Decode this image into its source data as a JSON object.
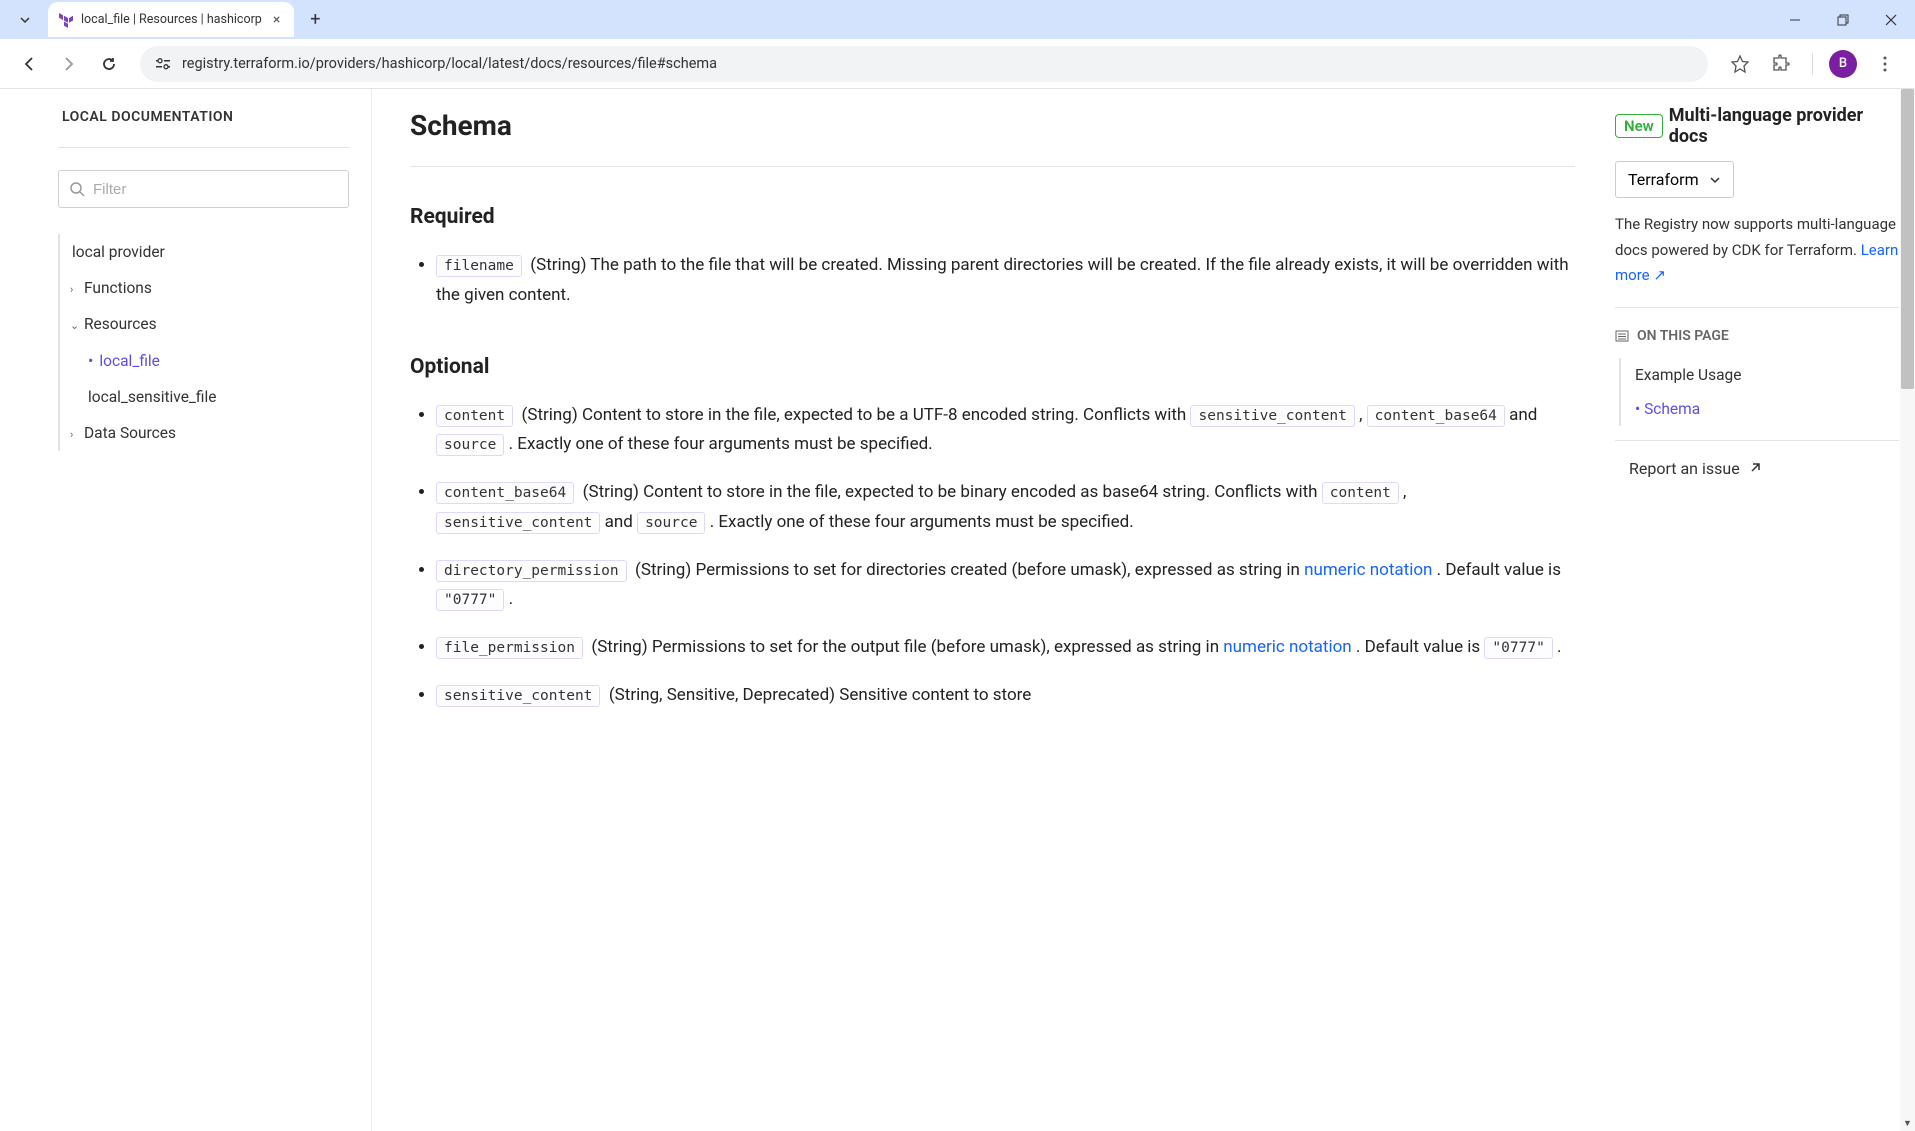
{
  "browser": {
    "tab_title": "local_file | Resources | hashicorp",
    "url": "registry.terraform.io/providers/hashicorp/local/latest/docs/resources/file#schema",
    "avatar_letter": "B"
  },
  "sidebar": {
    "title": "LOCAL DOCUMENTATION",
    "filter_placeholder": "Filter",
    "items": [
      {
        "label": "local provider",
        "level": 0,
        "chev": ""
      },
      {
        "label": "Functions",
        "level": 1,
        "chev": "›"
      },
      {
        "label": "Resources",
        "level": 1,
        "chev": "⌄",
        "expanded": true
      },
      {
        "label": "local_file",
        "level": 2,
        "active": true
      },
      {
        "label": "local_sensitive_file",
        "level": 2
      },
      {
        "label": "Data Sources",
        "level": 1,
        "chev": "›"
      }
    ]
  },
  "main": {
    "heading_schema": "Schema",
    "heading_required": "Required",
    "heading_optional": "Optional",
    "required": [
      {
        "code": "filename",
        "desc": "(String) The path to the file that will be created. Missing parent directories will be created. If the file already exists, it will be overridden with the given content."
      }
    ],
    "optional": {
      "content": {
        "code": "content",
        "text1": "(String) Content to store in the file, expected to be a UTF-8 encoded string. Conflicts with ",
        "conflict1": "sensitive_content",
        "conflict2": "content_base64",
        "and": " and ",
        "conflict3": "source",
        "text2": ". Exactly one of these four arguments must be specified."
      },
      "content_base64": {
        "code": "content_base64",
        "text1": "(String) Content to store in the file, expected to be binary encoded as base64 string. Conflicts with ",
        "conflict1": "content",
        "conflict2": "sensitive_content",
        "and": " and ",
        "conflict3": "source",
        "text2": ". Exactly one of these four arguments must be specified."
      },
      "directory_permission": {
        "code": "directory_permission",
        "text1": "(String) Permissions to set for directories created (before umask), expressed as string in ",
        "link": "numeric notation",
        "text2": ". Default value is ",
        "default": "\"0777\"",
        "text3": "."
      },
      "file_permission": {
        "code": "file_permission",
        "text1": "(String) Permissions to set for the output file (before umask), expressed as string in ",
        "link": "numeric notation",
        "text2": ". Default value is ",
        "default": "\"0777\"",
        "text3": "."
      },
      "sensitive_content": {
        "code": "sensitive_content",
        "text1": "(String, Sensitive, Deprecated) Sensitive content to store"
      }
    }
  },
  "rightcol": {
    "new_badge": "New",
    "ml_title": "Multi-language provider docs",
    "lang_selected": "Terraform",
    "ml_text": "The Registry now supports multi-language docs powered by CDK for Terraform. ",
    "learn_more": "Learn more",
    "otp_title": "ON THIS PAGE",
    "otp_items": [
      {
        "label": "Example Usage",
        "active": false
      },
      {
        "label": "Schema",
        "active": true
      }
    ],
    "report": "Report an issue"
  }
}
